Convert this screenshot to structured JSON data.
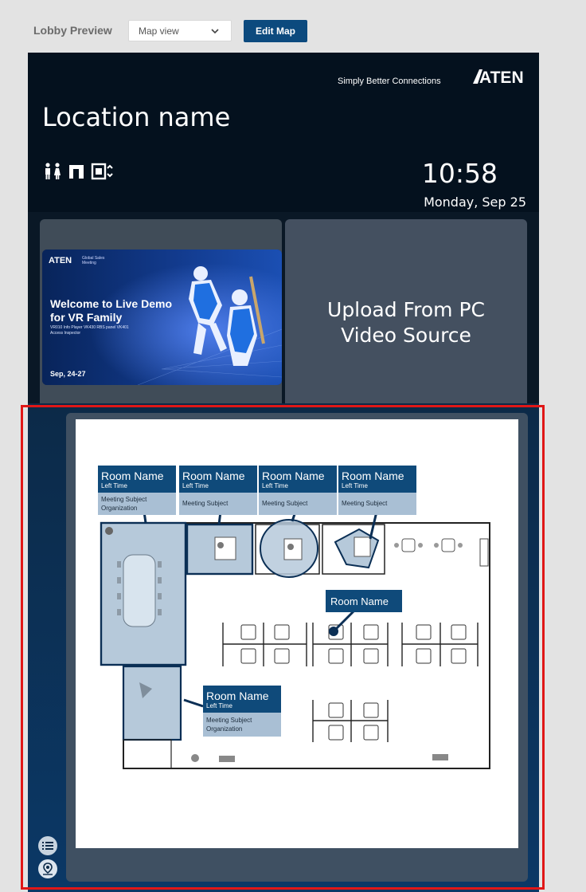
{
  "toolbar": {
    "label": "Lobby Preview",
    "view_select_value": "Map view",
    "edit_button_label": "Edit Map"
  },
  "header": {
    "tagline": "Simply Better Connections",
    "brand": "ATEN",
    "location_name": "Location name",
    "time": "10:58",
    "date": "Monday, Sep 25"
  },
  "tiles": {
    "promo": {
      "logo": "ATEN",
      "sub": "Global Sales Meeting",
      "headline": "Welcome to Live Demo for VR Family",
      "details": "VR010 Info Player VK430 RBS panel VK401 Access Inspector",
      "dates": "Sep, 24-27"
    },
    "upload_line1": "Upload From PC",
    "upload_line2": "Video Source"
  },
  "map": {
    "room_cards": [
      {
        "name": "Room Name",
        "time": "Left Time",
        "subject": "Meeting Subject",
        "org": "Organization"
      },
      {
        "name": "Room Name",
        "time": "Left Time",
        "subject": "Meeting Subject",
        "org": ""
      },
      {
        "name": "Room Name",
        "time": "Left Time",
        "subject": "Meeting Subject",
        "org": ""
      },
      {
        "name": "Room Name",
        "time": "Left Time",
        "subject": "Meeting Subject",
        "org": ""
      },
      {
        "name": "Room Name",
        "time": "Left Time",
        "subject": "Meeting Subject",
        "org": "Organization"
      }
    ],
    "pin_label": "Room Name"
  },
  "colors": {
    "accent": "#0c4a7e",
    "card_head": "#0f4a7a",
    "card_body": "#a9bfd4",
    "highlight": "#e01717"
  }
}
